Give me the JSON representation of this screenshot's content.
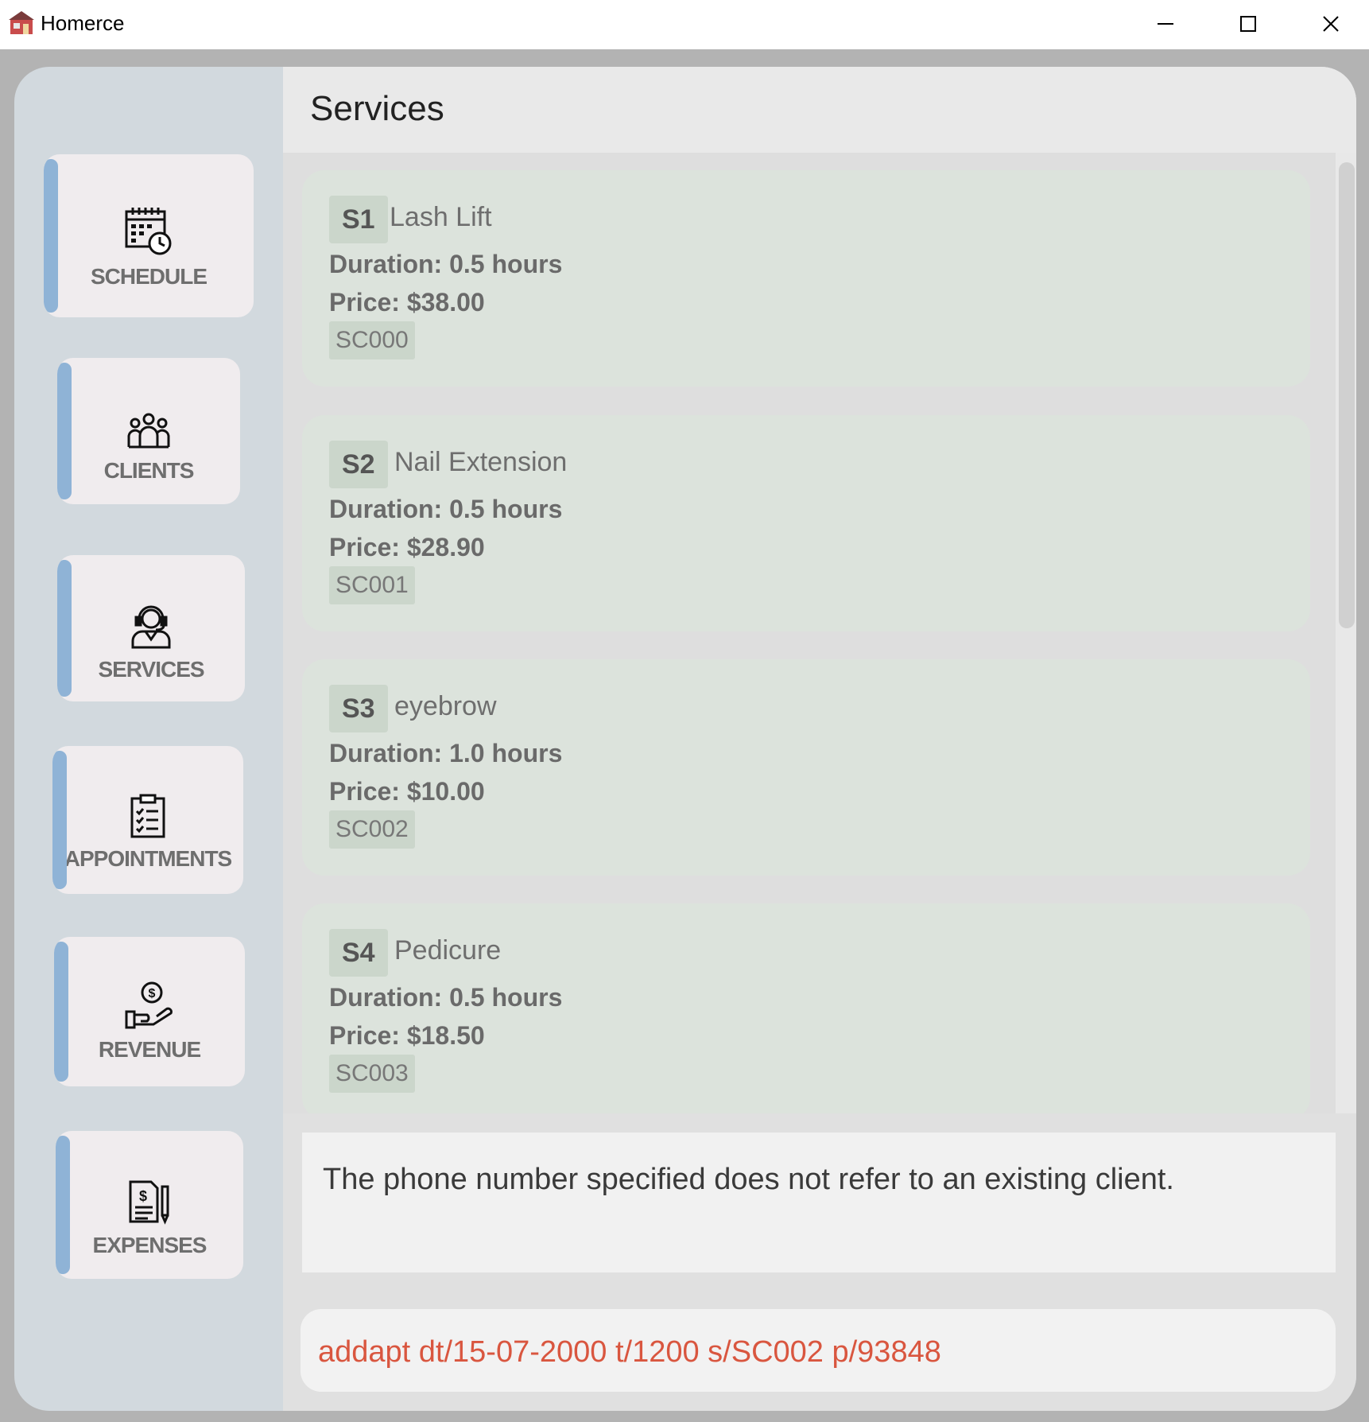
{
  "window": {
    "title": "Homerce",
    "controls": {
      "minimize": "minimize-icon",
      "maximize": "maximize-icon",
      "close": "close-icon"
    }
  },
  "sidebar": {
    "items": [
      {
        "label": "SCHEDULE",
        "icon": "calendar-clock-icon"
      },
      {
        "label": "CLIENTS",
        "icon": "people-group-icon"
      },
      {
        "label": "SERVICES",
        "icon": "headset-person-icon"
      },
      {
        "label": "APPOINTMENTS",
        "icon": "clipboard-checklist-icon"
      },
      {
        "label": "REVENUE",
        "icon": "hand-dollar-icon"
      },
      {
        "label": "EXPENSES",
        "icon": "invoice-pen-icon"
      }
    ]
  },
  "header": {
    "title": "Services"
  },
  "services": [
    {
      "index": "S1",
      "name": "Lash Lift",
      "duration": "Duration: 0.5 hours",
      "price": "Price: $38.00",
      "code": "SC000"
    },
    {
      "index": "S2",
      "name": "Nail Extension",
      "duration": "Duration: 0.5 hours",
      "price": "Price: $28.90",
      "code": "SC001"
    },
    {
      "index": "S3",
      "name": "eyebrow",
      "duration": "Duration: 1.0 hours",
      "price": "Price: $10.00",
      "code": "SC002"
    },
    {
      "index": "S4",
      "name": "Pedicure",
      "duration": "Duration: 0.5 hours",
      "price": "Price: $18.50",
      "code": "SC003"
    }
  ],
  "result": {
    "message": "The phone number specified does not refer to an existing client."
  },
  "command": {
    "value": "addapt dt/15-07-2000 t/1200 s/SC002 p/93848"
  },
  "colors": {
    "accent_bar": "#8fb3d6",
    "card_bg": "#dce3dc",
    "command_text": "#d9563f"
  }
}
